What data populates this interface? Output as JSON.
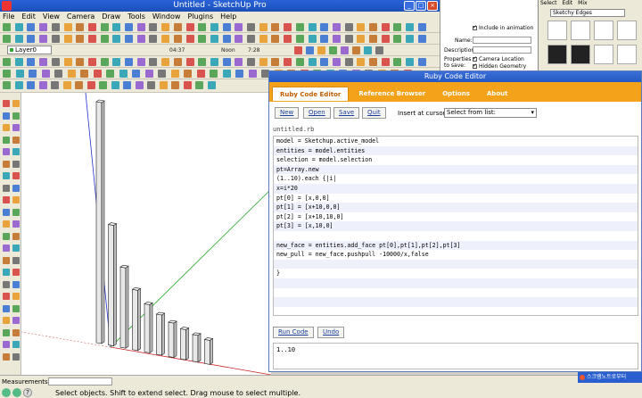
{
  "sketchup": {
    "title": "Untitled - SketchUp Pro",
    "menu": [
      "File",
      "Edit",
      "View",
      "Camera",
      "Draw",
      "Tools",
      "Window",
      "Plugins",
      "Help"
    ],
    "layer": "Layer0",
    "toolbar_readouts": [
      "04:37",
      "Noon",
      "7:28"
    ],
    "status": {
      "measurements_label": "Measurements",
      "message": "Select objects. Shift to extend select. Drag mouse to select multiple."
    }
  },
  "animation_panel": {
    "include_label": "Include in animation",
    "name_label": "Name:",
    "description_label": "Description:",
    "properties_label": "Properties to save:",
    "camera_location": "Camera Location",
    "hidden_geometry": "Hidden Geometry"
  },
  "styles_panel": {
    "tabs": [
      "Select",
      "Edit",
      "Mix"
    ],
    "selected_style": "Sketchy Edges"
  },
  "ruby_editor": {
    "title": "Ruby Code Editor",
    "tabs": [
      "Ruby Code Editor",
      "Reference Browser",
      "Options",
      "About"
    ],
    "buttons": {
      "new": "New",
      "open": "Open",
      "save": "Save",
      "quit": "Quit",
      "run": "Run Code",
      "undo": "Undo"
    },
    "insert_label": "Insert at cursor:",
    "insert_value": "Select from list:",
    "filename": "untitled.rb",
    "code_lines": [
      "model = Sketchup.active_model",
      "entities = model.entities",
      "selection = model.selection",
      "pt=Array.new",
      "(1..10).each {|i|",
      "x=i*20",
      "pt[0] = [x,0,0]",
      "pt[1] = [x+10,0,0]",
      "pt[2] = [x+10,10,0]",
      "pt[3] = [x,10,0]",
      "",
      "new_face = entities.add_face pt[0],pt[1],pt[2],pt[3]",
      "new_pull = new_face.pushpull -10000/x,false",
      "",
      "}",
      "",
      "",
      "",
      ""
    ],
    "output": "1..10"
  },
  "tray": {
    "label": "스크램노트로부터"
  },
  "colors": {
    "title_bar": "#2a63d8",
    "tab_strip": "#f3a21a",
    "link_blue": "#1a3d9a"
  }
}
